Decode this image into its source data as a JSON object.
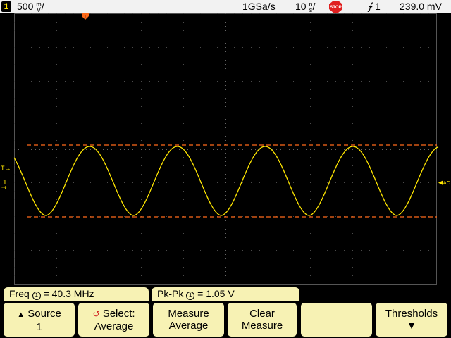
{
  "status": {
    "channel": "1",
    "scale": "500",
    "scale_unit_top": "m",
    "scale_unit_bottom": "V",
    "sample_rate": "1GSa/s",
    "timebase": "10",
    "timebase_unit_top": "n",
    "timebase_unit_bottom": "s",
    "run_state": "STOP",
    "trigger_source": "1",
    "trigger_level": "239.0 mV"
  },
  "markers": {
    "trigger_pos": "T",
    "channel_ground": "1",
    "trigger_level": "T",
    "ac_label": "AC"
  },
  "measurements": {
    "freq_label": "Freq",
    "freq_channel": "1",
    "freq_value": "= 40.3 MHz",
    "pkpk_label": "Pk-Pk",
    "pkpk_channel": "1",
    "pkpk_value": "= 1.05  V"
  },
  "softkeys": {
    "source_line1": "Source",
    "source_line2": "1",
    "select_line1": "Select:",
    "select_line2": "Average",
    "measure_line1": "Measure",
    "measure_line2": "Average",
    "clear_line1": "Clear",
    "clear_line2": "Measure",
    "thresholds": "Thresholds"
  },
  "colors": {
    "trace": "#ffe600",
    "cursor": "#ff6a1a",
    "softkey": "#f7f2b4"
  }
}
